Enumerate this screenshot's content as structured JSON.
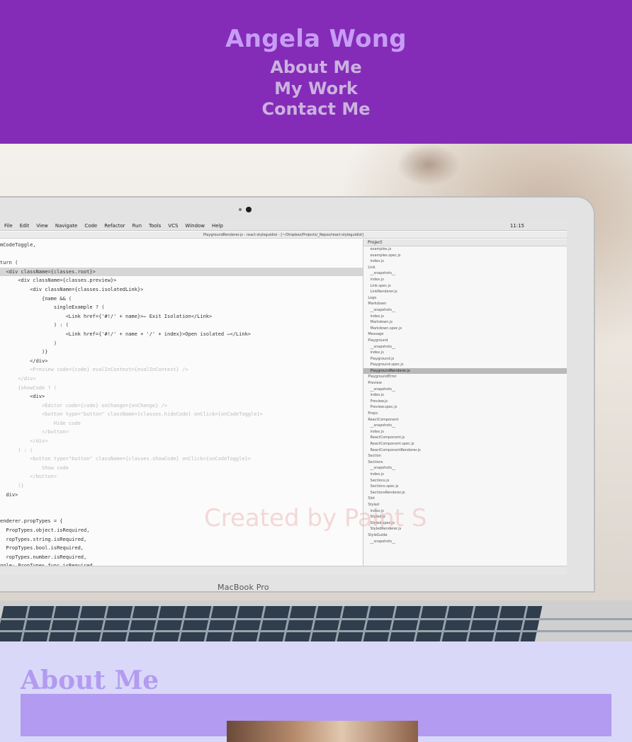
{
  "header": {
    "title": "Angela Wong",
    "nav": [
      {
        "label": "About Me"
      },
      {
        "label": "My Work"
      },
      {
        "label": "Contact Me"
      }
    ]
  },
  "hero": {
    "menubar": {
      "items": [
        "File",
        "Edit",
        "View",
        "Navigate",
        "Code",
        "Refactor",
        "Run",
        "Tools",
        "VCS",
        "Window",
        "Help"
      ],
      "clock": "11:15"
    },
    "window_title": "PlaygroundRenderer.js - react-styleguidist - [~/Dropbox/Projects/_Repos/react-styleguidist]",
    "code_lines": [
      "mCodeToggle,",
      "",
      "turn (",
      "  <div className={classes.root}>",
      "      <div className={classes.preview}>",
      "          <div className={classes.isolatedLink}>",
      "              {name && (",
      "                  singleExample ? (",
      "                      <Link href={'#!/' + name}>⇽ Exit Isolation</Link>",
      "                  ) : (",
      "                      <Link href={'#!/' + name + '/' + index}>Open isolated ⇾</Link>",
      "                  )",
      "              )}",
      "          </div>",
      "          <Preview code={code} evalInContext={evalInContext} />",
      "      </div>",
      "      {showCode ? (",
      "          <div>",
      "              <Editor code={code} onChange={onChange} />",
      "              <button type=\"button\" className={classes.hideCode} onClick={onCodeToggle}>",
      "                  Hide code",
      "              </button>",
      "          </div>",
      "      ) : (",
      "          <button type=\"button\" className={classes.showCode} onClick={onCodeToggle}>",
      "              Show code",
      "          </button>",
      "      )}",
      "  div>",
      "",
      "",
      "enderer.propTypes = {",
      "  PropTypes.object.isRequired,",
      "  ropTypes.string.isRequired,",
      "  PropTypes.bool.isRequired,",
      "  ropTypes.number.isRequired,",
      "ggle: PropTypes.func.isRequired,"
    ],
    "project_label": "Project",
    "tree_rows": [
      "      examples.js",
      "      examples.spec.js",
      "      index.js",
      "    Link",
      "      __snapshots__",
      "      index.js",
      "      Link.spec.js",
      "      LinkRenderer.js",
      "    Logo",
      "    Markdown",
      "      __snapshots__",
      "      index.js",
      "      Markdown.js",
      "      Markdown.spec.js",
      "    Message",
      "    Playground",
      "      __snapshots__",
      "      index.js",
      "      Playground.js",
      "      Playground.spec.js",
      "      PlaygroundRenderer.js",
      "    PlaygroundError",
      "    Preview",
      "      __snapshots__",
      "      index.js",
      "      Preview.js",
      "      Preview.spec.js",
      "    Props",
      "    ReactComponent",
      "      __snapshots__",
      "      index.js",
      "      ReactComponent.js",
      "      ReactComponent.spec.js",
      "      ReactComponentRenderer.js",
      "    Section",
      "    Sections",
      "      __snapshots__",
      "      index.js",
      "      Sections.js",
      "      Sections.spec.js",
      "      SectionsRenderer.js",
      "    Slot",
      "    Styled",
      "      index.js",
      "      Styled.js",
      "      Styled.spec.js",
      "      StyledRenderer.js",
      "    StyleGuide",
      "      __snapshots__"
    ],
    "selected_tree_row": 20,
    "brand": "MacBook Pro",
    "watermark": "Created by Paint S"
  },
  "about": {
    "heading": "About Me"
  },
  "colors": {
    "header_bg": "#842cb8",
    "title": "#c89cf5",
    "nav_link": "#cbb2de",
    "page_bg": "#dad8f9",
    "accent": "#b29bf0"
  }
}
